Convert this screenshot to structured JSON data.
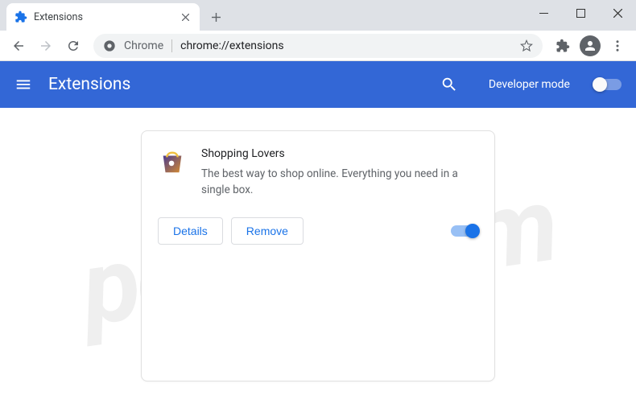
{
  "window": {
    "tab_title": "Extensions"
  },
  "toolbar": {
    "omnibox_prefix": "Chrome",
    "omnibox_url": "chrome://extensions"
  },
  "header": {
    "title": "Extensions",
    "developer_mode_label": "Developer mode"
  },
  "extension": {
    "name": "Shopping Lovers",
    "description": "The best way to shop online. Everything you need in a single box.",
    "details_label": "Details",
    "remove_label": "Remove",
    "enabled": true
  }
}
